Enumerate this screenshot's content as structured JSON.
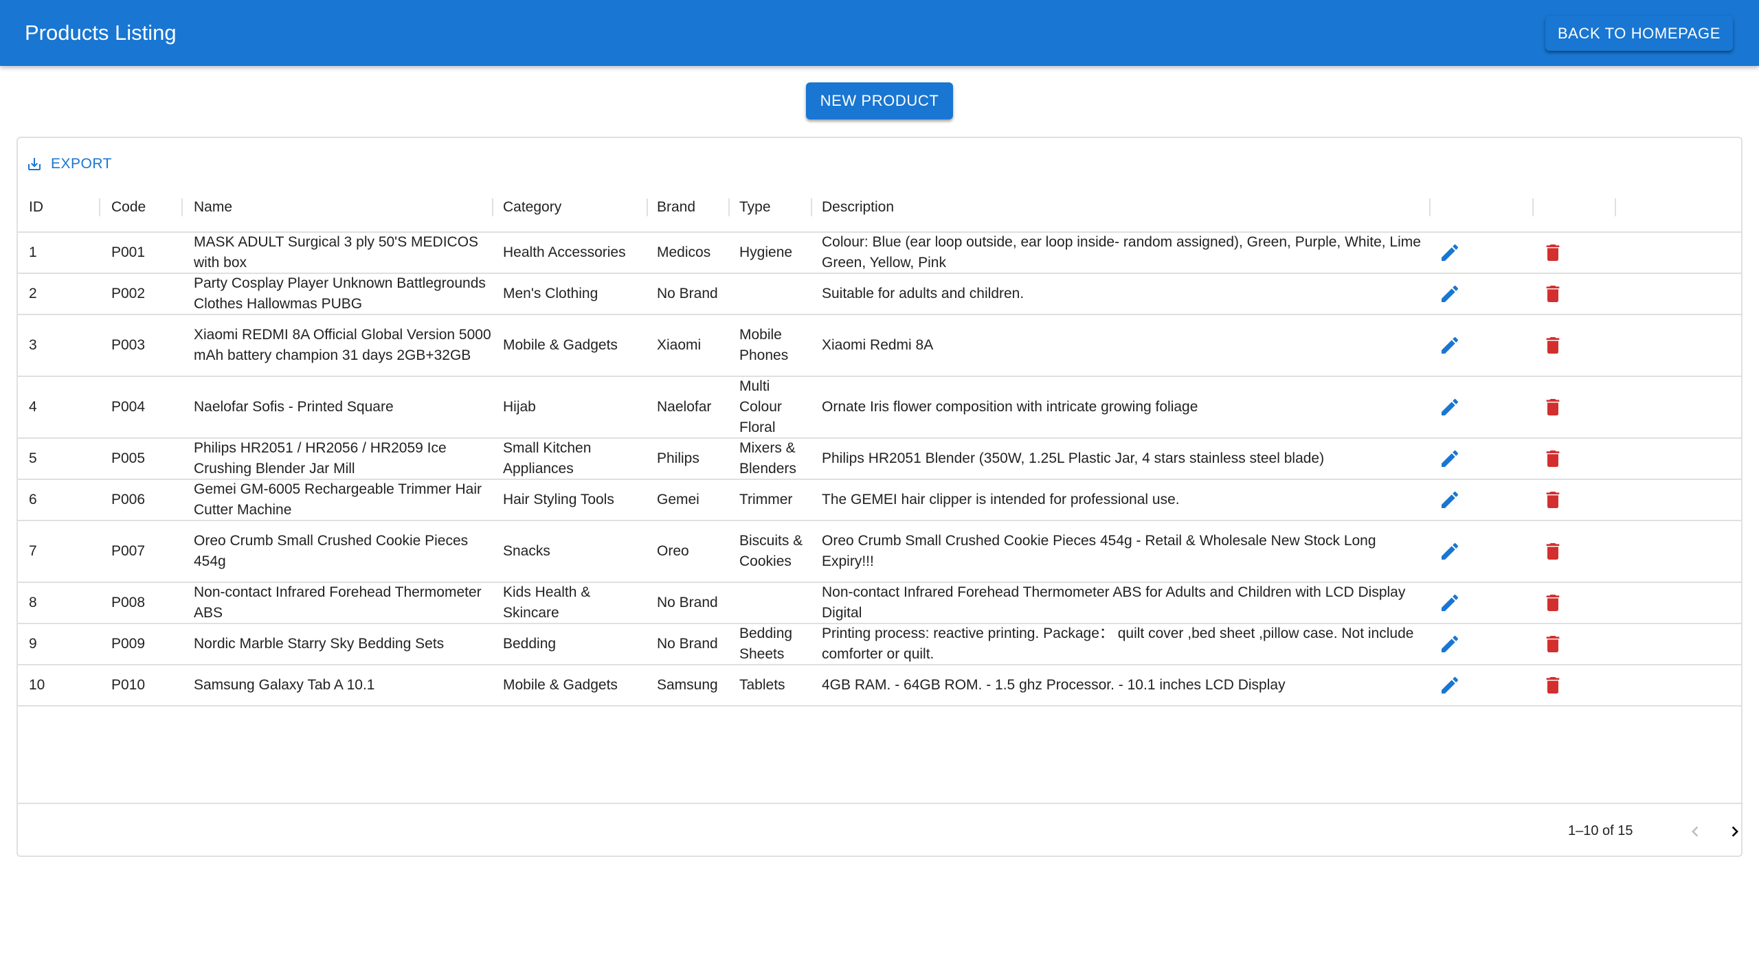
{
  "appbar": {
    "title": "Products Listing",
    "back_label": "BACK TO HOMEPAGE"
  },
  "toolbar": {
    "new_label": "NEW PRODUCT",
    "export_label": "EXPORT"
  },
  "table": {
    "columns": [
      "ID",
      "Code",
      "Name",
      "Category",
      "Brand",
      "Type",
      "Description"
    ],
    "rows": [
      {
        "id": "1",
        "code": "P001",
        "name": "MASK ADULT Surgical 3 ply 50'S MEDICOS with box",
        "category": "Health Accessories",
        "brand": "Medicos",
        "type": "Hygiene",
        "description": "Colour: Blue (ear loop outside, ear loop inside- random assigned), Green, Purple, White, Lime Green, Yellow, Pink"
      },
      {
        "id": "2",
        "code": "P002",
        "name": "Party Cosplay Player Unknown Battlegrounds Clothes Hallowmas PUBG",
        "category": "Men's Clothing",
        "brand": "No Brand",
        "type": "",
        "description": "Suitable for adults and children."
      },
      {
        "id": "3",
        "code": "P003",
        "name": "Xiaomi REDMI 8A Official Global Version 5000 mAh battery champion 31 days 2GB+32GB",
        "category": "Mobile & Gadgets",
        "brand": "Xiaomi",
        "type": "Mobile Phones",
        "description": "Xiaomi Redmi 8A"
      },
      {
        "id": "4",
        "code": "P004",
        "name": "Naelofar Sofis - Printed Square",
        "category": "Hijab",
        "brand": "Naelofar",
        "type": "Multi Colour Floral",
        "description": "Ornate Iris flower composition with intricate growing foliage"
      },
      {
        "id": "5",
        "code": "P005",
        "name": "Philips HR2051 / HR2056 / HR2059 Ice Crushing Blender Jar Mill",
        "category": "Small Kitchen Appliances",
        "brand": "Philips",
        "type": "Mixers & Blenders",
        "description": "Philips HR2051 Blender (350W, 1.25L Plastic Jar, 4 stars stainless steel blade)"
      },
      {
        "id": "6",
        "code": "P006",
        "name": "Gemei GM-6005 Rechargeable Trimmer Hair Cutter Machine",
        "category": "Hair Styling Tools",
        "brand": "Gemei",
        "type": "Trimmer",
        "description": "The GEMEI hair clipper is intended for professional use."
      },
      {
        "id": "7",
        "code": "P007",
        "name": "Oreo Crumb Small Crushed Cookie Pieces 454g",
        "category": "Snacks",
        "brand": "Oreo",
        "type": "Biscuits & Cookies",
        "description": "Oreo Crumb Small Crushed Cookie Pieces 454g - Retail & Wholesale New Stock Long Expiry!!!"
      },
      {
        "id": "8",
        "code": "P008",
        "name": "Non-contact Infrared Forehead Thermometer ABS",
        "category": "Kids Health & Skincare",
        "brand": "No Brand",
        "type": "",
        "description": "Non-contact Infrared Forehead Thermometer ABS for Adults and Children with LCD Display Digital"
      },
      {
        "id": "9",
        "code": "P009",
        "name": "Nordic Marble Starry Sky Bedding Sets",
        "category": "Bedding",
        "brand": "No Brand",
        "type": "Bedding Sheets",
        "description": "Printing process: reactive printing. Package： quilt cover ,bed sheet ,pillow case. Not include comforter or quilt."
      },
      {
        "id": "10",
        "code": "P010",
        "name": "Samsung Galaxy Tab A 10.1",
        "category": "Mobile & Gadgets",
        "brand": "Samsung",
        "type": "Tablets",
        "description": "4GB RAM. - 64GB ROM. - 1.5 ghz Processor. - 10.1 inches LCD Display"
      }
    ]
  },
  "pagination": {
    "label": "1–10 of 15"
  },
  "icons": {
    "edit": "pencil-icon",
    "delete": "trash-icon",
    "export": "download-icon",
    "prev": "chevron-left-icon",
    "next": "chevron-right-icon"
  },
  "colors": {
    "primary": "#1976d2",
    "danger": "#d32f2f",
    "disabled": "#bdbdbd"
  }
}
